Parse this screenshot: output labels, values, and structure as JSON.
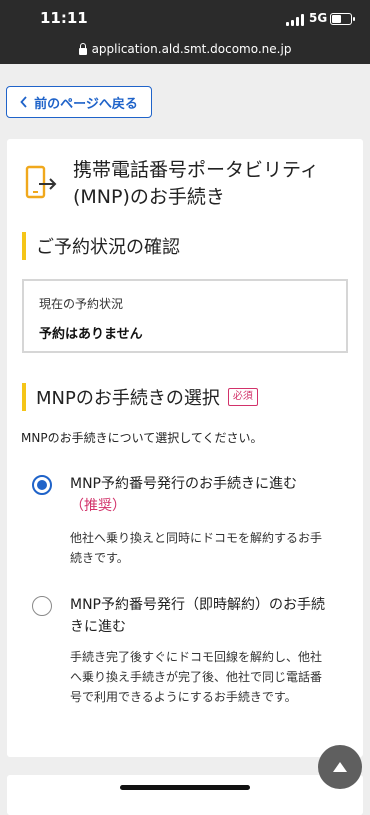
{
  "status_bar": {
    "time": "11:11",
    "network": "5G",
    "battery_level": 0.55
  },
  "browser": {
    "url": "application.ald.smt.docomo.ne.jp"
  },
  "back_button": {
    "label": "前のページへ戻る"
  },
  "page": {
    "title": "携帯電話番号ポータビリティ(MNP)のお手続き",
    "icon": "phone-transfer-icon"
  },
  "reservation": {
    "heading": "ご予約状況の確認",
    "status_label": "現在の予約状況",
    "status_value": "予約はありません"
  },
  "mnp_selection": {
    "heading": "MNPのお手続きの選択",
    "required_badge": "必須",
    "description": "MNPのお手続きについて選択してください。",
    "options": [
      {
        "label": "MNP予約番号発行のお手続きに進む",
        "tag": "（推奨）",
        "description": "他社へ乗り換えと同時にドコモを解約するお手続きです。",
        "selected": true
      },
      {
        "label": "MNP予約番号発行（即時解約）のお手続きに進む",
        "description": "手続き完了後すぐにドコモ回線を解約し、他社へ乗り換え手続きが完了後、他社で同じ電話番号で利用できるようにするお手続きです。",
        "selected": false
      }
    ]
  },
  "colors": {
    "accent": "#1f63c9",
    "heading_bar": "#f5c518",
    "required": "#d2326a",
    "page_bg": "#eeeeee"
  }
}
